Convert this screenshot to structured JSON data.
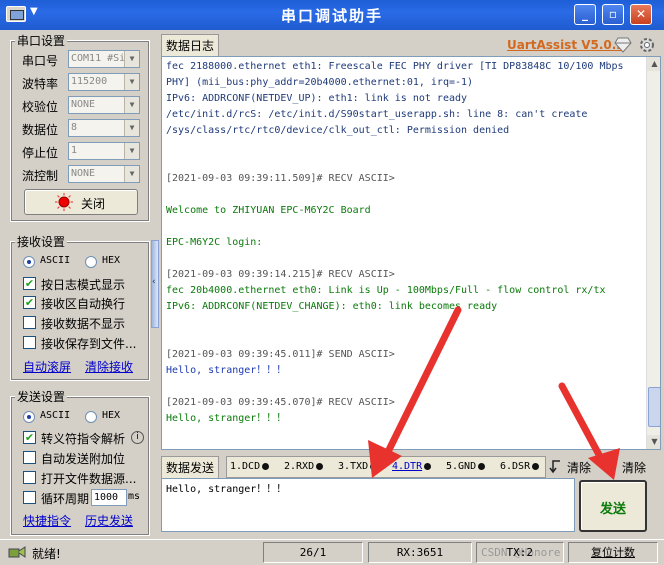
{
  "window": {
    "title": "串口调试助手",
    "sys_menu_arrow": "▼",
    "buttons": {
      "minimize": "_",
      "restore": "▫",
      "close": "✕"
    }
  },
  "serial": {
    "legend": "串口设置",
    "port_label": "串口号",
    "port_value": "COM11 #Si",
    "baud_label": "波特率",
    "baud_value": "115200",
    "parity_label": "校验位",
    "parity_value": "NONE",
    "databits_label": "数据位",
    "databits_value": "8",
    "stopbits_label": "停止位",
    "stopbits_value": "1",
    "flow_label": "流控制",
    "flow_value": "NONE",
    "close_button": "关闭"
  },
  "receive": {
    "legend": "接收设置",
    "ascii": "ASCII",
    "hex": "HEX",
    "ascii_selected": true,
    "log_mode": "按日志模式显示",
    "log_mode_checked": true,
    "auto_newline": "接收区自动换行",
    "auto_newline_checked": true,
    "no_display": "接收数据不显示",
    "no_display_checked": false,
    "save_to_file": "接收保存到文件...",
    "save_to_file_checked": false,
    "auto_scroll_link": "自动滚屏",
    "clear_link": "清除接收"
  },
  "send": {
    "legend": "发送设置",
    "ascii": "ASCII",
    "hex": "HEX",
    "ascii_selected": true,
    "escape": "转义符指令解析",
    "escape_checked": true,
    "auto_append": "自动发送附加位",
    "auto_append_checked": false,
    "open_file": "打开文件数据源...",
    "open_file_checked": false,
    "cycle": "循环周期",
    "cycle_value": "1000",
    "cycle_unit": "ms",
    "cycle_checked": false,
    "shortcut_link": "快捷指令",
    "history_link": "历史发送"
  },
  "log_tab": "数据日志",
  "brand": "UartAssist V5.0.2",
  "log_lines": [
    {
      "text": "fec 2188000.ethernet eth1: Freescale FEC PHY driver [TI DP83848C 10/100 Mbps",
      "cls": "c-b"
    },
    {
      "text": "PHY] (mii_bus:phy_addr=20b4000.ethernet:01, irq=-1)",
      "cls": "c-b"
    },
    {
      "text": "IPv6: ADDRCONF(NETDEV_UP): eth1: link is not ready",
      "cls": "c-b"
    },
    {
      "text": "/etc/init.d/rcS: /etc/init.d/S90start_userapp.sh: line 8: can't create",
      "cls": "c-b"
    },
    {
      "text": "/sys/class/rtc/rtc0/device/clk_out_ctl: Permission denied",
      "cls": "c-b"
    },
    {
      "text": "",
      "cls": ""
    },
    {
      "text": "",
      "cls": ""
    },
    {
      "text": "[2021-09-03 09:39:11.509]# RECV ASCII>",
      "cls": "c-h"
    },
    {
      "text": "",
      "cls": ""
    },
    {
      "text": "Welcome to ZHIYUAN EPC-M6Y2C Board",
      "cls": "c-g"
    },
    {
      "text": "",
      "cls": ""
    },
    {
      "text": "EPC-M6Y2C login:",
      "cls": "c-g"
    },
    {
      "text": "",
      "cls": ""
    },
    {
      "text": "[2021-09-03 09:39:14.215]# RECV ASCII>",
      "cls": "c-h"
    },
    {
      "text": "fec 20b4000.ethernet eth0: Link is Up - 100Mbps/Full - flow control rx/tx",
      "cls": "c-g"
    },
    {
      "text": "IPv6: ADDRCONF(NETDEV_CHANGE): eth0: link becomes ready",
      "cls": "c-g"
    },
    {
      "text": "",
      "cls": ""
    },
    {
      "text": "",
      "cls": ""
    },
    {
      "text": "[2021-09-03 09:39:45.011]# SEND ASCII>",
      "cls": "c-h"
    },
    {
      "text": "Hello, stranger！！！",
      "cls": "c-s"
    },
    {
      "text": "",
      "cls": ""
    },
    {
      "text": "[2021-09-03 09:39:45.070]# RECV ASCII>",
      "cls": "c-h"
    },
    {
      "text": "Hello, stranger！！！",
      "cls": "c-g"
    }
  ],
  "send_tab": "数据发送",
  "signals": {
    "dcd": "1.DCD",
    "rxd": "2.RXD",
    "txd": "3.TXD",
    "dtr": "4.DTR",
    "gnd": "5.GND",
    "dsr": "6.DSR"
  },
  "clear1": "清除",
  "clear2": "清除",
  "send_text": "Hello, stranger！！！",
  "send_button": "发送",
  "status": {
    "ready": "就绪!",
    "counter": "26/1",
    "rx": "RX:3651",
    "tx": "TX:2",
    "watermark": "CSDN @Honore",
    "reset": "复位计数"
  }
}
